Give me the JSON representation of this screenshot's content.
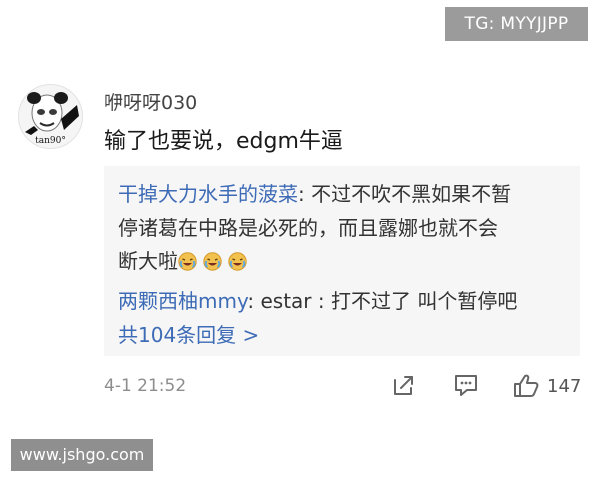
{
  "watermarks": {
    "top_right": "TG: MYYJJPP",
    "bottom_left": "www.jshgo.com"
  },
  "comment": {
    "avatar": {
      "label": "tan90°",
      "icon": "panda-meme-avatar-icon"
    },
    "username": "咿呀呀030",
    "text": "输了也要说，edgm牛逼",
    "timestamp": "4-1 21:52",
    "like_count": "147"
  },
  "replies": {
    "first": {
      "author": "干掉大力水手的菠菜",
      "separator": ":",
      "line1": "不过不吹不黑如果不暂",
      "line2": "停诸葛在中路是必死的，而且露娜也就不会",
      "line3": "断大啦"
    },
    "second": {
      "author": "两颗西柚mmy",
      "separator": ":",
      "text": "estar : 打不过了 叫个暂停吧"
    },
    "more_label": "共104条回复 >"
  },
  "icons": {
    "share": "share-icon",
    "comment": "comment-icon",
    "like": "thumbs-up-icon",
    "emoji": "laughing-crying-emoji-icon"
  },
  "colors": {
    "link_blue": "#3d6bb6",
    "reply_background": "#f6f6f6",
    "muted_gray": "#8d8d8d",
    "emoji_yellow": "#f2c14e"
  }
}
